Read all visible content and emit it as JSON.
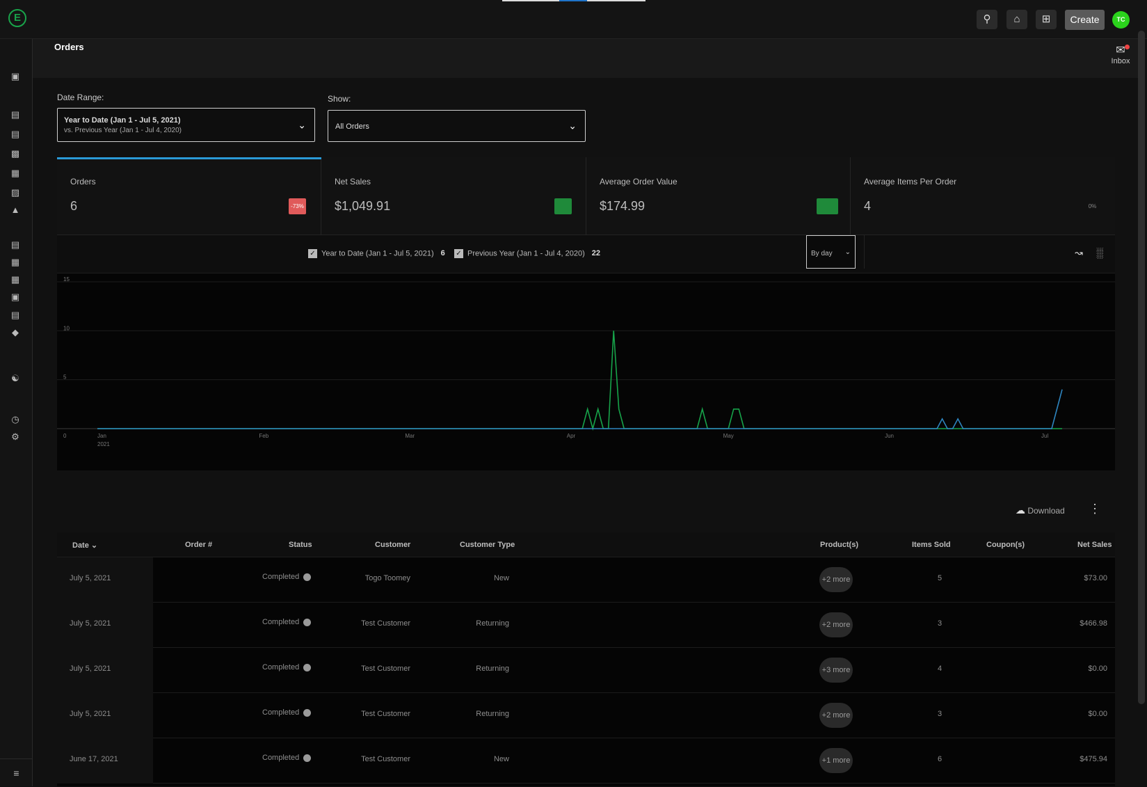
{
  "topbar": {
    "logo_letter": "E",
    "icons": [
      "search-icon",
      "home-icon",
      "sliders-icon"
    ],
    "create_label": "Create",
    "avatar_initials": "TC"
  },
  "sidebar": {
    "icons": [
      "dashboard-icon",
      "photos-icon",
      "document-icon",
      "pages-icon",
      "comments-icon",
      "news-icon",
      "analytics-icon",
      "card-icon",
      "store-icon",
      "catalog-icon",
      "reports-icon",
      "list-icon",
      "tag-icon",
      "users-icon",
      "clock-icon",
      "settings-icon"
    ],
    "collapse_icon": "collapse-menu-icon"
  },
  "header": {
    "title": "Orders",
    "inbox_label": "Inbox"
  },
  "filters": {
    "date_range_label": "Date Range:",
    "date_range_primary": "Year to Date (Jan 1 - Jul 5, 2021)",
    "date_range_secondary": "vs. Previous Year (Jan 1 - Jul 4, 2020)",
    "show_label": "Show:",
    "show_value": "All Orders"
  },
  "kpis": [
    {
      "label": "Orders",
      "value": "6",
      "badge": "-73%",
      "badge_color": "#e05a5a"
    },
    {
      "label": "Net Sales",
      "value": "$1,049.91",
      "badge": "",
      "badge_color": "#1f8a3a"
    },
    {
      "label": "Average Order Value",
      "value": "$174.99",
      "badge": "",
      "badge_color": "#1f8a3a"
    },
    {
      "label": "Average Items Per Order",
      "value": "4",
      "badge": "0%",
      "badge_color": "transparent"
    }
  ],
  "chart_controls": {
    "legend_current": "Year to Date (Jan 1 - Jul 5, 2021)",
    "legend_current_count": "6",
    "legend_previous": "Previous Year (Jan 1 - Jul 4, 2020)",
    "legend_previous_count": "22",
    "interval": "By day"
  },
  "chart_data": {
    "type": "line",
    "ylim": [
      0,
      15
    ],
    "yticks": [
      "0",
      "5",
      "10",
      "15"
    ],
    "xticks": [
      {
        "label": "Jan",
        "sub": "2021",
        "day": 1
      },
      {
        "label": "Feb",
        "sub": "",
        "day": 32
      },
      {
        "label": "Mar",
        "sub": "",
        "day": 60
      },
      {
        "label": "Apr",
        "sub": "",
        "day": 91
      },
      {
        "label": "May",
        "sub": "",
        "day": 121
      },
      {
        "label": "Jun",
        "sub": "",
        "day": 152
      },
      {
        "label": "Jul",
        "sub": "",
        "day": 182
      }
    ],
    "xmax_day": 186,
    "series": [
      {
        "color": "#17a34a",
        "points": [
          [
            1,
            0
          ],
          [
            94,
            0
          ],
          [
            95,
            2
          ],
          [
            96,
            0
          ],
          [
            97,
            2
          ],
          [
            98,
            0
          ],
          [
            99,
            0
          ],
          [
            100,
            10
          ],
          [
            101,
            2
          ],
          [
            102,
            0
          ],
          [
            116,
            0
          ],
          [
            117,
            2
          ],
          [
            118,
            0
          ],
          [
            122,
            0
          ],
          [
            123,
            2
          ],
          [
            124,
            2
          ],
          [
            125,
            0
          ],
          [
            186,
            0
          ]
        ]
      },
      {
        "color": "#2e86c1",
        "points": [
          [
            1,
            0
          ],
          [
            162,
            0
          ],
          [
            163,
            1
          ],
          [
            164,
            0
          ],
          [
            165,
            0
          ],
          [
            166,
            1
          ],
          [
            167,
            0
          ],
          [
            184,
            0
          ],
          [
            186,
            4
          ]
        ]
      }
    ]
  },
  "table": {
    "download_label": "Download",
    "headers": {
      "date": "Date",
      "order": "Order #",
      "status": "Status",
      "customer": "Customer",
      "customer_type": "Customer Type",
      "products": "Product(s)",
      "items_sold": "Items Sold",
      "coupons": "Coupon(s)",
      "net_sales": "Net Sales"
    },
    "rows": [
      {
        "date": "July 5, 2021",
        "order": "",
        "status": "Completed",
        "customer": "Togo Toomey",
        "customer_type": "New",
        "products": "+2 more",
        "items_sold": "5",
        "coupons": "",
        "net_sales": "$73.00"
      },
      {
        "date": "July 5, 2021",
        "order": "",
        "status": "Completed",
        "customer": "Test Customer",
        "customer_type": "Returning",
        "products": "+2 more",
        "items_sold": "3",
        "coupons": "",
        "net_sales": "$466.98"
      },
      {
        "date": "July 5, 2021",
        "order": "",
        "status": "Completed",
        "customer": "Test Customer",
        "customer_type": "Returning",
        "products": "+3 more",
        "items_sold": "4",
        "coupons": "",
        "net_sales": "$0.00"
      },
      {
        "date": "July 5, 2021",
        "order": "",
        "status": "Completed",
        "customer": "Test Customer",
        "customer_type": "Returning",
        "products": "+2 more",
        "items_sold": "3",
        "coupons": "",
        "net_sales": "$0.00"
      },
      {
        "date": "June 17, 2021",
        "order": "",
        "status": "Completed",
        "customer": "Test Customer",
        "customer_type": "New",
        "products": "+1 more",
        "items_sold": "6",
        "coupons": "",
        "net_sales": "$475.94"
      }
    ]
  }
}
